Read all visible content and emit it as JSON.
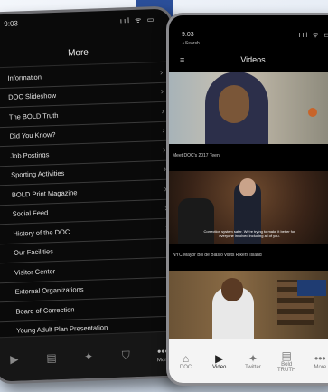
{
  "left_phone": {
    "status": {
      "time": "9:03",
      "icons": "ııl ᯤ ▭"
    },
    "title": "More",
    "menu_items": [
      "Information",
      "DOC Slideshow",
      "The BOLD Truth",
      "Did You Know?",
      "Job Postings",
      "Sporting Activities",
      "BOLD Print Magazine",
      "Social Feed",
      "History of the DOC",
      "Our Facilities",
      "Visitor Center",
      "External Organizations",
      "Board of Correction",
      "Young Adult Plan Presentation"
    ],
    "tabs": [
      {
        "icon": "video-icon",
        "glyph": "▶",
        "label": ""
      },
      {
        "icon": "news-icon",
        "glyph": "▤",
        "label": ""
      },
      {
        "icon": "twitter-icon",
        "glyph": "✦",
        "label": ""
      },
      {
        "icon": "shield-icon",
        "glyph": "⛉",
        "label": ""
      },
      {
        "icon": "more-icon",
        "glyph": "•••",
        "label": "More"
      }
    ]
  },
  "right_phone": {
    "status": {
      "time": "9:03",
      "back": "◂ Search",
      "icons": "ııl ᯤ ▭"
    },
    "title": "Videos",
    "videos": [
      {
        "caption": "Meet DOC's 2017 Teen",
        "subtitle": ""
      },
      {
        "caption": "NYC Mayor Bill de Blasio visits Rikers Island",
        "subtitle": "Correction system safer. We're trying to make it better for everyone involved including all of you."
      },
      {
        "caption": "",
        "subtitle": ""
      }
    ],
    "tabs": [
      {
        "icon": "home-icon",
        "glyph": "⌂",
        "label": "DOC"
      },
      {
        "icon": "video-icon",
        "glyph": "▶",
        "label": "Video"
      },
      {
        "icon": "twitter-icon",
        "glyph": "✦",
        "label": "Twitter"
      },
      {
        "icon": "bold-truth-icon",
        "glyph": "▤",
        "label": "Bold TRUTH"
      },
      {
        "icon": "more-icon",
        "glyph": "•••",
        "label": "More"
      }
    ]
  }
}
